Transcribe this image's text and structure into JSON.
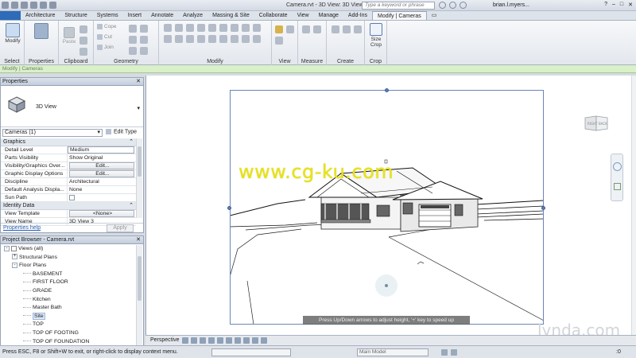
{
  "titlebar": {
    "title": "Camera.rvt - 3D View: 3D View 3",
    "search_placeholder": "Type a keyword or phrase",
    "user": "brian.l.myers..."
  },
  "tabs": [
    "Architecture",
    "Structure",
    "Systems",
    "Insert",
    "Annotate",
    "Analyze",
    "Massing & Site",
    "Collaborate",
    "View",
    "Manage",
    "Add-Ins",
    "Modify | Cameras"
  ],
  "ribbon": {
    "select": {
      "button": "Modify",
      "label": "Select"
    },
    "properties": {
      "label": "Properties"
    },
    "clipboard": {
      "paste": "Paste",
      "label": "Clipboard"
    },
    "geometry": {
      "cope": "Cope",
      "cut": "Cut",
      "join": "Join",
      "label": "Geometry"
    },
    "modify": {
      "label": "Modify"
    },
    "view": {
      "label": "View"
    },
    "measure": {
      "label": "Measure"
    },
    "create": {
      "label": "Create"
    },
    "crop": {
      "button": "Size Crop",
      "label": "Crop"
    }
  },
  "contextual_strip": "Modify | Cameras",
  "properties": {
    "title": "Properties",
    "type_name": "3D View",
    "instance_selector": "Cameras (1)",
    "edit_type": "Edit Type",
    "sections": [
      {
        "name": "Graphics",
        "rows": [
          {
            "key": "Detail Level",
            "value": "Medium"
          },
          {
            "key": "Parts Visibility",
            "value": "Show Original"
          },
          {
            "key": "Visibility/Graphics Over...",
            "value": "Edit..."
          },
          {
            "key": "Graphic Display Options",
            "value": "Edit..."
          },
          {
            "key": "Discipline",
            "value": "Architectural"
          },
          {
            "key": "Default Analysis Displa...",
            "value": "None"
          },
          {
            "key": "Sun Path",
            "value": ""
          }
        ]
      },
      {
        "name": "Identity Data",
        "rows": [
          {
            "key": "View Template",
            "value": "<None>"
          },
          {
            "key": "View Name",
            "value": "3D View 3"
          }
        ]
      }
    ],
    "help_link": "Properties help",
    "apply": "Apply"
  },
  "browser": {
    "title": "Project Browser - Camera.rvt",
    "items": [
      {
        "label": "Views (all)",
        "level": 0,
        "toggle": "-"
      },
      {
        "label": "Structural Plans",
        "level": 1,
        "toggle": "+"
      },
      {
        "label": "Floor Plans",
        "level": 1,
        "toggle": "-"
      },
      {
        "label": "BASEMENT",
        "level": 2
      },
      {
        "label": "FIRST FLOOR",
        "level": 2
      },
      {
        "label": "GRADE",
        "level": 2
      },
      {
        "label": "Kitchen",
        "level": 2
      },
      {
        "label": "Master Bath",
        "level": 2
      },
      {
        "label": "Site",
        "level": 2,
        "selected": true
      },
      {
        "label": "TOP",
        "level": 2
      },
      {
        "label": "TOP OF FOOTING",
        "level": 2
      },
      {
        "label": "TOP OF FOUNDATION",
        "level": 2
      }
    ]
  },
  "canvas": {
    "hint": "Press Up/Down arrows to adjust height, '+' key to speed up",
    "watermark": "www.cg-ku.com",
    "viewcube": "SE",
    "brand": "lynda.com"
  },
  "viewbar": {
    "label": "Perspective"
  },
  "statusbar": {
    "message": "Press ESC, F8 or Shift+W to exit, or right-click to display context menu.",
    "model": "Main Model",
    "zero": ":0"
  },
  "colors": {
    "accent": "#2e6bb8",
    "crop_border": "#6b86b8",
    "contextual": "#d9f0c8"
  }
}
